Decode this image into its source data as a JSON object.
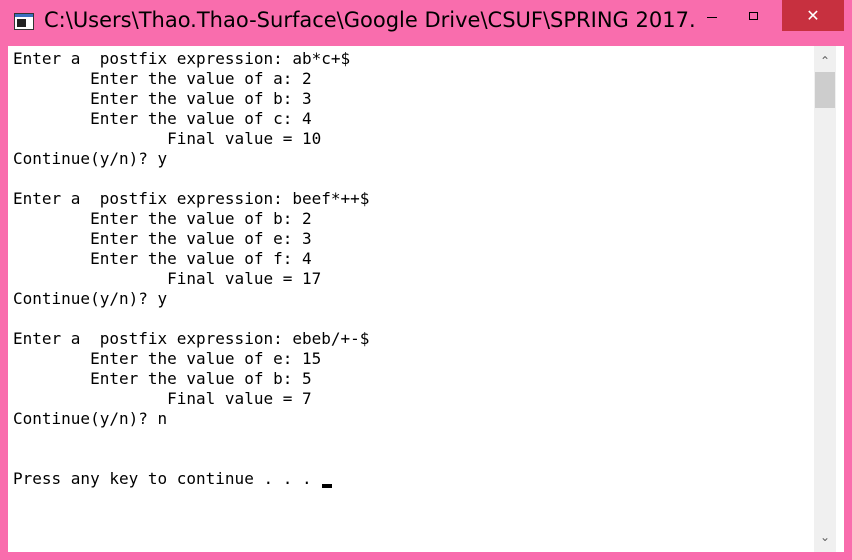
{
  "window": {
    "title": "C:\\Users\\Thao.Thao-Surface\\Google Drive\\CSUF\\SPRING 2017...",
    "minimize_glyph": "",
    "close_glyph": "✕"
  },
  "console": {
    "lines": [
      "Enter a  postfix expression: ab*c+$",
      "        Enter the value of a: 2",
      "        Enter the value of b: 3",
      "        Enter the value of c: 4",
      "                Final value = 10",
      "Continue(y/n)? y",
      "",
      "Enter a  postfix expression: beef*++$",
      "        Enter the value of b: 2",
      "        Enter the value of e: 3",
      "        Enter the value of f: 4",
      "                Final value = 17",
      "Continue(y/n)? y",
      "",
      "Enter a  postfix expression: ebeb/+-$",
      "        Enter the value of e: 15",
      "        Enter the value of b: 5",
      "                Final value = 7",
      "Continue(y/n)? n",
      "",
      "",
      "Press any key to continue . . . "
    ]
  },
  "scrollbar": {
    "up_icon": "chevron-up-icon",
    "down_icon": "chevron-down-icon",
    "up_glyph": "⌃",
    "down_glyph": "⌄"
  },
  "colors": {
    "frame": "#f96dad",
    "close_button": "#c7303f",
    "console_bg": "#ffffff",
    "console_text": "#000000"
  }
}
